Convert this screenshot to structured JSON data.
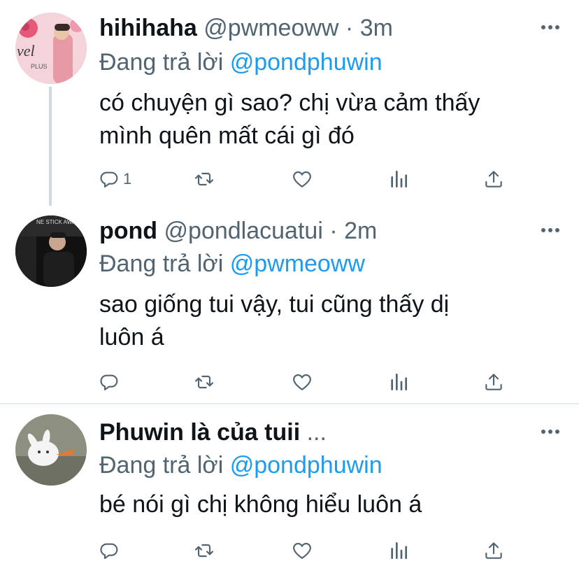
{
  "tweets": [
    {
      "name": "hihihaha",
      "handle_time": "@pwmeoww · 3m",
      "replying_prefix": "Đang trả lời",
      "replying_to": "@pondphuwin",
      "text_lines": [
        "có chuyện gì sao? chị vừa cảm thấy",
        "mình quên mất cái gì đó"
      ],
      "reply_count": "1",
      "avatar_text": "vel",
      "avatar_subtext": "PLUS"
    },
    {
      "name": "pond",
      "handle_time": "@pondlacuatui · 2m",
      "replying_prefix": "Đang trả lời",
      "replying_to": "@pwmeoww",
      "text_lines": [
        "sao giống tui vậy, tui cũng thấy dị",
        "luôn á"
      ],
      "reply_count": "",
      "avatar_text": "NE STICK AWARD"
    },
    {
      "name": "Phuwin là của tuii",
      "handle_time": " ...",
      "replying_prefix": "Đang trả lời",
      "replying_to": "@pondphuwin",
      "text_lines": [
        "bé nói gì chị không hiểu luôn á"
      ],
      "reply_count": ""
    }
  ],
  "icons": {
    "reply": "reply-icon",
    "retweet": "retweet-icon",
    "like": "heart-icon",
    "analytics": "analytics-icon",
    "share": "share-icon",
    "more": "more-icon"
  },
  "colors": {
    "link": "#1d9bf0",
    "secondary": "#536471",
    "text": "#0f1419",
    "divider": "#e6ecf0"
  }
}
